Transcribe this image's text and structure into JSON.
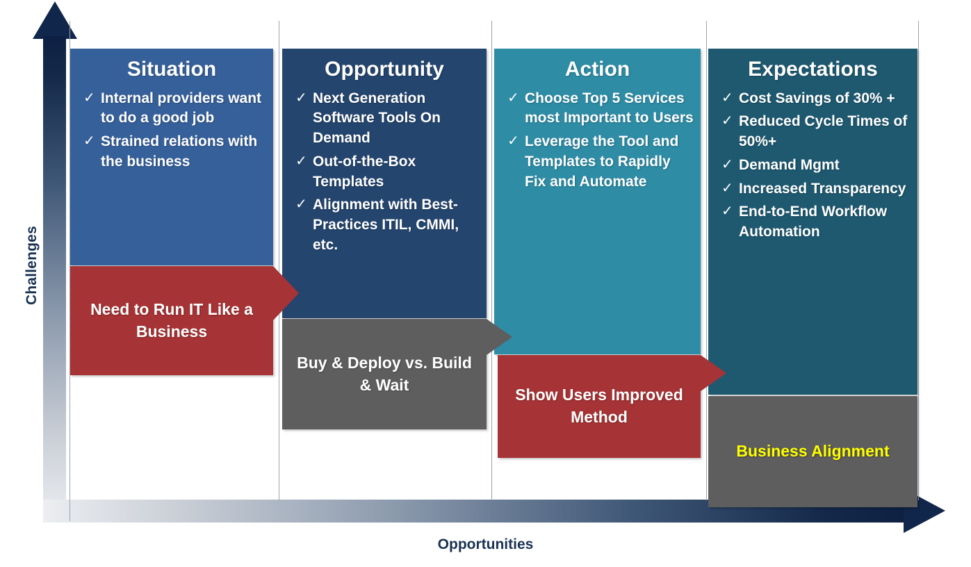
{
  "axes": {
    "y_label": "Challenges",
    "x_label": "Opportunities",
    "axis_color": "#10264a",
    "label_color": "#1a3253"
  },
  "columns": [
    {
      "title": "Situation",
      "color": "#36609a",
      "check": "✓",
      "bullets": [
        "Internal providers want to do a good job",
        "Strained relations with the business"
      ]
    },
    {
      "title": "Opportunity",
      "color": "#24456e",
      "check": "✓",
      "bullets": [
        "Next Generation Software Tools On Demand",
        "Out-of-the-Box Templates",
        "Alignment with Best-Practices ITIL, CMMI, etc."
      ]
    },
    {
      "title": "Action",
      "color": "#2e8ca5",
      "check": "✓",
      "bullets": [
        "Choose Top 5 Services most Important to Users",
        "Leverage the Tool and Templates to Rapidly Fix and Automate"
      ]
    },
    {
      "title": "Expectations",
      "color": "#1e5970",
      "check": "✓",
      "bullets": [
        "Cost Savings of 30% +",
        "Reduced Cycle Times of 50%+",
        "Demand Mgmt",
        "Increased Transparency",
        "End-to-End Workflow Automation"
      ]
    }
  ],
  "banners": [
    {
      "text": "Need to Run IT Like a Business",
      "color": "#a63335",
      "text_color": "#ffffff",
      "shape": "arrow"
    },
    {
      "text": "Buy & Deploy vs. Build & Wait",
      "color": "#5e5e5e",
      "text_color": "#ffffff",
      "shape": "arrow"
    },
    {
      "text": "Show Users Improved Method",
      "color": "#a63335",
      "text_color": "#ffffff",
      "shape": "arrow"
    },
    {
      "text": "Business Alignment",
      "color": "#5e5e5e",
      "text_color": "#ffff00",
      "shape": "box"
    }
  ]
}
